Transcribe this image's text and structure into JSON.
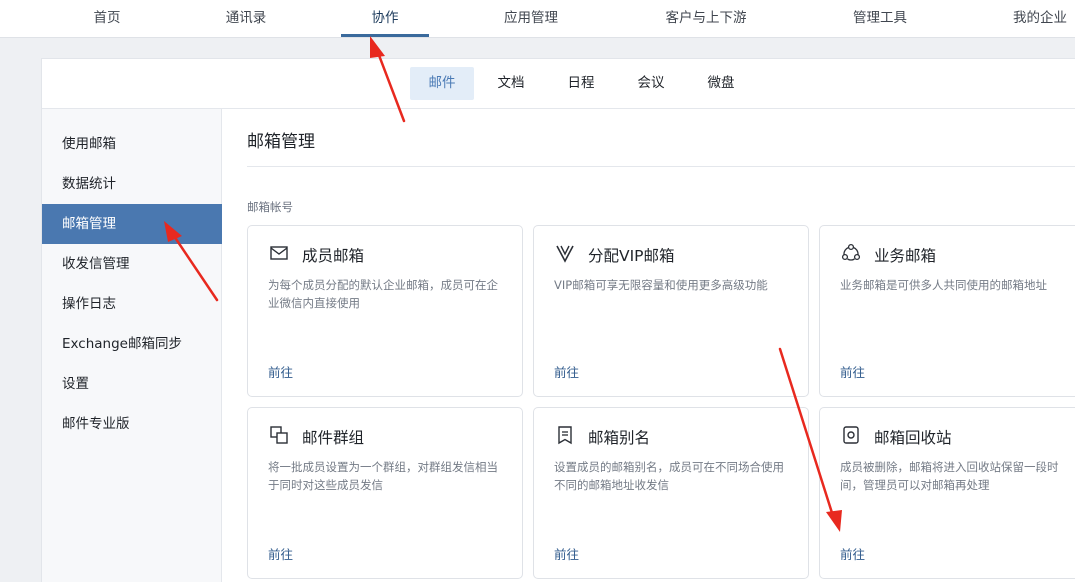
{
  "topnav": {
    "items": [
      {
        "label": "首页"
      },
      {
        "label": "通讯录"
      },
      {
        "label": "协作"
      },
      {
        "label": "应用管理"
      },
      {
        "label": "客户与上下游"
      },
      {
        "label": "管理工具"
      },
      {
        "label": "我的企业"
      }
    ],
    "active": "协作"
  },
  "subnav": {
    "tabs": [
      {
        "label": "邮件"
      },
      {
        "label": "文档"
      },
      {
        "label": "日程"
      },
      {
        "label": "会议"
      },
      {
        "label": "微盘"
      }
    ],
    "active": "邮件"
  },
  "sidebar": {
    "items": [
      {
        "label": "使用邮箱"
      },
      {
        "label": "数据统计"
      },
      {
        "label": "邮箱管理"
      },
      {
        "label": "收发信管理"
      },
      {
        "label": "操作日志"
      },
      {
        "label": "Exchange邮箱同步"
      },
      {
        "label": "设置"
      },
      {
        "label": "邮件专业版"
      }
    ],
    "active": "邮箱管理"
  },
  "main": {
    "title": "邮箱管理",
    "section_label": "邮箱帐号",
    "cards": [
      {
        "icon": "envelope-icon",
        "title": "成员邮箱",
        "desc": "为每个成员分配的默认企业邮箱，成员可在企业微信内直接使用",
        "link": "前往"
      },
      {
        "icon": "vip-icon",
        "title": "分配VIP邮箱",
        "desc": "VIP邮箱可享无限容量和使用更多高级功能",
        "link": "前往"
      },
      {
        "icon": "business-mailbox-icon",
        "title": "业务邮箱",
        "desc": "业务邮箱是可供多人共同使用的邮箱地址",
        "link": "前往"
      },
      {
        "icon": "mail-group-icon",
        "title": "邮件群组",
        "desc": "将一批成员设置为一个群组，对群组发信相当于同时对这些成员发信",
        "link": "前往"
      },
      {
        "icon": "mailbox-alias-icon",
        "title": "邮箱别名",
        "desc": "设置成员的邮箱别名，成员可在不同场合使用不同的邮箱地址收发信",
        "link": "前往"
      },
      {
        "icon": "recycle-bin-icon",
        "title": "邮箱回收站",
        "desc": "成员被删除，邮箱将进入回收站保留一段时间，管理员可以对邮箱再处理",
        "link": "前往"
      }
    ]
  },
  "colors": {
    "accent": "#4a78b0",
    "link": "#335d8e",
    "annotation_arrow": "#e8291f"
  }
}
